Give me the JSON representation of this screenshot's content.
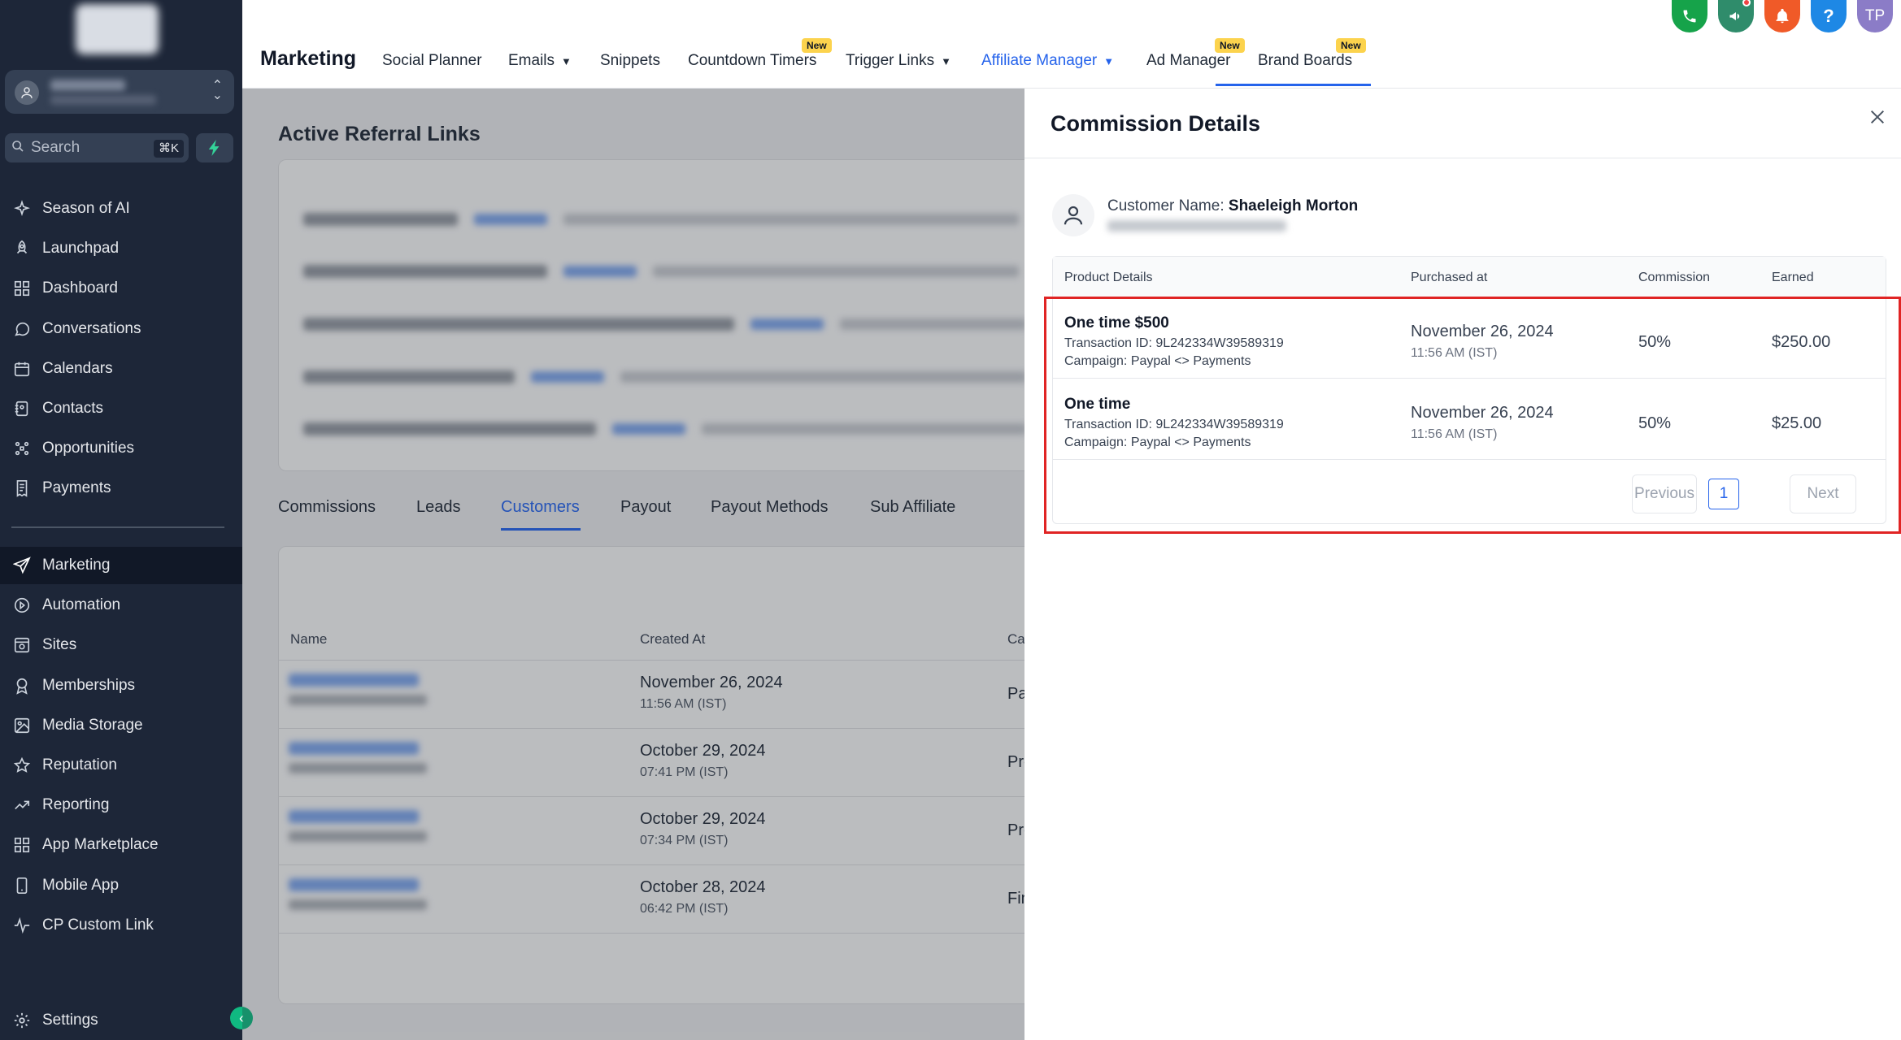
{
  "sidebar": {
    "search_placeholder": "Search",
    "search_shortcut": "⌘K",
    "items": [
      {
        "label": "Season of AI",
        "icon": "sparkle-icon"
      },
      {
        "label": "Launchpad",
        "icon": "rocket-icon"
      },
      {
        "label": "Dashboard",
        "icon": "grid-icon"
      },
      {
        "label": "Conversations",
        "icon": "chat-icon"
      },
      {
        "label": "Calendars",
        "icon": "calendar-icon"
      },
      {
        "label": "Contacts",
        "icon": "contacts-icon"
      },
      {
        "label": "Opportunities",
        "icon": "opportunities-icon"
      },
      {
        "label": "Payments",
        "icon": "receipt-icon"
      }
    ],
    "items2": [
      {
        "label": "Marketing",
        "icon": "send-icon"
      },
      {
        "label": "Automation",
        "icon": "automation-icon"
      },
      {
        "label": "Sites",
        "icon": "sites-icon"
      },
      {
        "label": "Memberships",
        "icon": "badge-icon"
      },
      {
        "label": "Media Storage",
        "icon": "image-icon"
      },
      {
        "label": "Reputation",
        "icon": "star-icon"
      },
      {
        "label": "Reporting",
        "icon": "trend-icon"
      },
      {
        "label": "App Marketplace",
        "icon": "apps-icon"
      },
      {
        "label": "Mobile App",
        "icon": "phone-icon"
      },
      {
        "label": "CP Custom Link",
        "icon": "link-icon"
      }
    ],
    "settings": "Settings"
  },
  "topnav": {
    "title": "Marketing",
    "tabs": [
      "Social Planner",
      "Emails",
      "Snippets",
      "Countdown Timers",
      "Trigger Links",
      "Affiliate Manager",
      "Ad Manager",
      "Brand Boards"
    ],
    "new_badge": "New",
    "avatar_initials": "TP",
    "help": "?"
  },
  "main": {
    "section_title": "Active Referral Links",
    "subtabs": [
      "Commissions",
      "Leads",
      "Customers",
      "Payout",
      "Payout Methods",
      "Sub Affiliate"
    ],
    "table_headers": [
      "Name",
      "Created At",
      "Campaig"
    ],
    "rows": [
      {
        "date": "November 26, 2024",
        "time": "11:56 AM (IST)",
        "campaign": "Paypal"
      },
      {
        "date": "October 29, 2024",
        "time": "07:41 PM (IST)",
        "campaign": "Produc"
      },
      {
        "date": "October 29, 2024",
        "time": "07:34 PM (IST)",
        "campaign": "Produc"
      },
      {
        "date": "October 28, 2024",
        "time": "06:42 PM (IST)",
        "campaign": "Final<>"
      }
    ]
  },
  "drawer": {
    "title": "Commission Details",
    "customer_label": "Customer Name:",
    "customer_name": "Shaeleigh Morton",
    "headers": [
      "Product Details",
      "Purchased at",
      "Commission",
      "Earned"
    ],
    "rows": [
      {
        "product": "One time $500",
        "transaction": "Transaction ID: 9L242334W39589319",
        "campaign": "Campaign: Paypal <> Payments",
        "date": "November 26, 2024",
        "time": "11:56 AM (IST)",
        "commission": "50%",
        "earned": "$250.00"
      },
      {
        "product": "One time",
        "transaction": "Transaction ID: 9L242334W39589319",
        "campaign": "Campaign: Paypal <> Payments",
        "date": "November 26, 2024",
        "time": "11:56 AM (IST)",
        "commission": "50%",
        "earned": "$25.00"
      }
    ],
    "pager": {
      "previous": "Previous",
      "page": "1",
      "next": "Next"
    }
  },
  "colors": {
    "sidebar_bg": "#1d2638",
    "accent": "#2563eb",
    "highlight": "#e02424",
    "badge": "#fcd34d"
  }
}
